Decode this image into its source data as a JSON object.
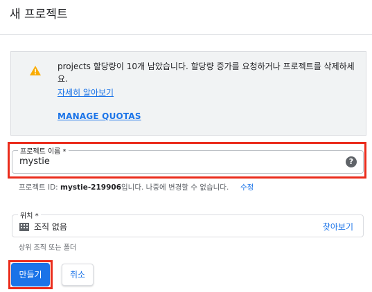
{
  "dialog": {
    "title": "새 프로젝트"
  },
  "notice": {
    "text": "projects 할당량이 10개 남았습니다. 할당량 증가를 요청하거나 프로젝트를 삭제하세요.",
    "learn_more": "자세히 알아보기",
    "manage_quotas": "MANAGE QUOTAS",
    "icon": "warning-icon"
  },
  "project_name": {
    "label": "프로젝트 이름 *",
    "value": "mystie",
    "help_glyph": "?"
  },
  "project_id": {
    "prefix": "프로젝트 ID: ",
    "id": "mystie-219906",
    "suffix": "입니다. 나중에 변경할 수 없습니다.",
    "edit": "수정"
  },
  "location": {
    "label": "위치 *",
    "value": "조직 없음",
    "browse": "찾아보기",
    "hint": "상위 조직 또는 폴더",
    "icon": "building-icon"
  },
  "buttons": {
    "create": "만들기",
    "cancel": "취소"
  },
  "colors": {
    "accent": "#1a73e8",
    "highlight": "#ea2b1b",
    "warning": "#f9ab00"
  }
}
